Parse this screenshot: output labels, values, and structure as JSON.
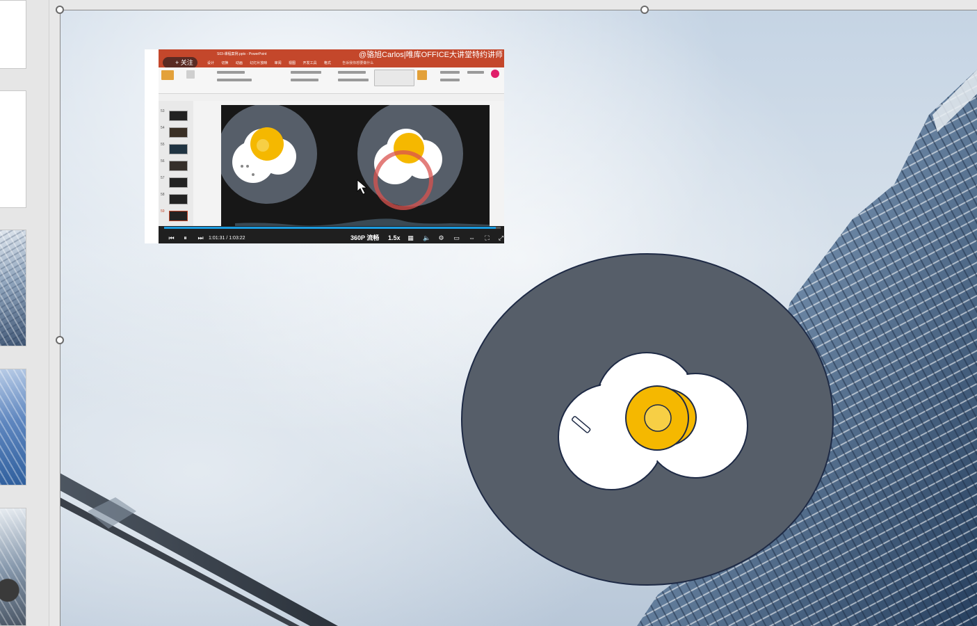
{
  "video": {
    "app_title": "S03-课程案例.pptx - PowerPoint",
    "watermark": "@骆旭Carlos|唯库OFFICE大讲堂特约讲师",
    "follow_label": "+ 关注",
    "tabs": [
      "文件",
      "开始",
      "插入",
      "设计",
      "切换",
      "动画",
      "幻灯片放映",
      "审阅",
      "视图",
      "开发工具",
      "格式"
    ],
    "tell_me": "告诉我你想要做什么",
    "slide_numbers": [
      "53",
      "54",
      "55",
      "56",
      "57",
      "58",
      "59"
    ],
    "progress": 0.985,
    "time_current": "1:01:31",
    "time_separator": "/",
    "time_total": "1:03:22",
    "quality": "360P 流畅",
    "speed": "1.5x"
  },
  "colors": {
    "plate": "#565e69",
    "plate_outline": "#1e2a45",
    "egg_white": "#ffffff",
    "yolk": "#f5b800",
    "yolk_inner": "#f7cf45",
    "ppt_red": "#c4472b",
    "progress": "#1b9ce0"
  }
}
